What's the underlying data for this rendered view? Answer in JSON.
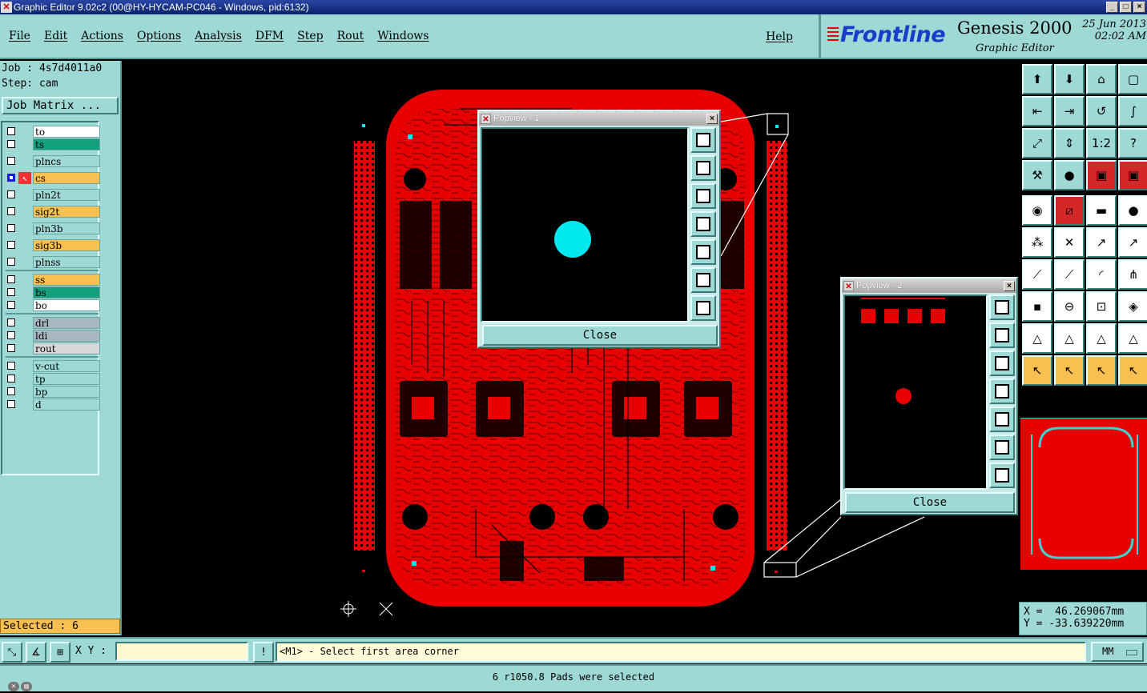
{
  "window": {
    "title": "Graphic Editor 9.02c2 (00@HY-HYCAM-PC046 - Windows, pid:6132)",
    "minimize": "_",
    "maximize": "□",
    "close": "×"
  },
  "menu": {
    "items": [
      "File",
      "Edit",
      "Actions",
      "Options",
      "Analysis",
      "DFM",
      "Step",
      "Rout",
      "Windows"
    ],
    "help": "Help"
  },
  "brand": {
    "logo": "Frontline",
    "product": "Genesis 2000",
    "subtitle": "Graphic Editor",
    "date": "25 Jun 2013",
    "time": "02:02 AM"
  },
  "job": {
    "job_line": "Job : 4s7d4011a0",
    "step_line": "Step: cam",
    "matrix_button": "Job Matrix ..."
  },
  "layers": [
    {
      "name": "to",
      "color": "#ffffff",
      "checked": false
    },
    {
      "name": "ts",
      "color": "#14a07c",
      "checked": false
    },
    {
      "name": "plncs",
      "color": "#9ed9d6",
      "checked": false
    },
    {
      "name": "cs",
      "color": "#f8c050",
      "checked": true
    },
    {
      "name": "pln2t",
      "color": "#9ed9d6",
      "checked": false
    },
    {
      "name": "sig2t",
      "color": "#f8c050",
      "checked": false
    },
    {
      "name": "pln3b",
      "color": "#9ed9d6",
      "checked": false
    },
    {
      "name": "sig3b",
      "color": "#f8c050",
      "checked": false
    },
    {
      "name": "plnss",
      "color": "#9ed9d6",
      "checked": false
    },
    {
      "name": "ss",
      "color": "#f8c050",
      "checked": false
    },
    {
      "name": "bs",
      "color": "#14a07c",
      "checked": false
    },
    {
      "name": "bo",
      "color": "#ffffff",
      "checked": false
    },
    {
      "name": "drl",
      "color": "#a8b8c0",
      "checked": false
    },
    {
      "name": "ldi",
      "color": "#a8b8c0",
      "checked": false
    },
    {
      "name": "rout",
      "color": "#d8d8d8",
      "checked": false
    },
    {
      "name": "v-cut",
      "color": "#9ed9d6",
      "checked": false
    },
    {
      "name": "tp",
      "color": "#9ed9d6",
      "checked": false
    },
    {
      "name": "bp",
      "color": "#9ed9d6",
      "checked": false
    },
    {
      "name": "d",
      "color": "#9ed9d6",
      "checked": false
    }
  ],
  "selected_text": "Selected : 6",
  "popview1": {
    "title": "Popview - 1",
    "close_label": "Close",
    "close_x": "×"
  },
  "popview2": {
    "title": "Popview - 2",
    "close_label": "Close",
    "close_x": "×"
  },
  "coords": {
    "x_line": "X =  46.269067mm",
    "y_line": "Y = -33.639220mm"
  },
  "command": {
    "xy_label": "X Y :",
    "xy_value": "",
    "prompt": "<M1> - Select first area corner",
    "unit": "MM"
  },
  "status": {
    "message": "6 r1050.8 Pads were selected"
  },
  "colors": {
    "panel": "#9ed9d6",
    "board": "#e80000",
    "highlight": "#00e8f0"
  }
}
